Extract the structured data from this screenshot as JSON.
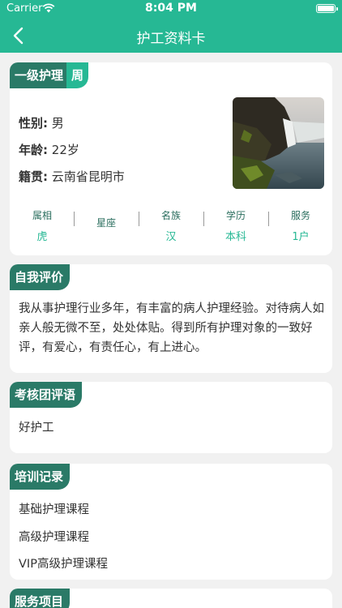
{
  "status_bar": {
    "carrier": "Carrier",
    "time": "8:04 PM"
  },
  "nav": {
    "title": "护工资料卡"
  },
  "profile": {
    "level": "一级护理",
    "period": "周",
    "gender_label": "性别:",
    "gender": "男",
    "age_label": "年龄:",
    "age": "22岁",
    "origin_label": "籍贯:",
    "origin": "云南省昆明市",
    "stats": [
      {
        "key": "属相",
        "value": "虎"
      },
      {
        "key": "星座",
        "value": ""
      },
      {
        "key": "名族",
        "value": "汉"
      },
      {
        "key": "学历",
        "value": "本科"
      },
      {
        "key": "服务",
        "value": "1户"
      }
    ]
  },
  "self_eval": {
    "title": "自我评价",
    "text": "我从事护理行业多年，有丰富的病人护理经验。对待病人如亲人般无微不至，处处体贴。得到所有护理对象的一致好评，有爱心，有责任心，有上进心。"
  },
  "review": {
    "title": "考核团评语",
    "text": "好护工"
  },
  "training": {
    "title": "培训记录",
    "items": [
      "基础护理课程",
      "高级护理课程",
      "VIP高级护理课程"
    ]
  },
  "services": {
    "title": "服务项目"
  },
  "colors": {
    "primary": "#26b894",
    "tag_dark": "#2a7a67",
    "background": "#f1f1f1"
  }
}
